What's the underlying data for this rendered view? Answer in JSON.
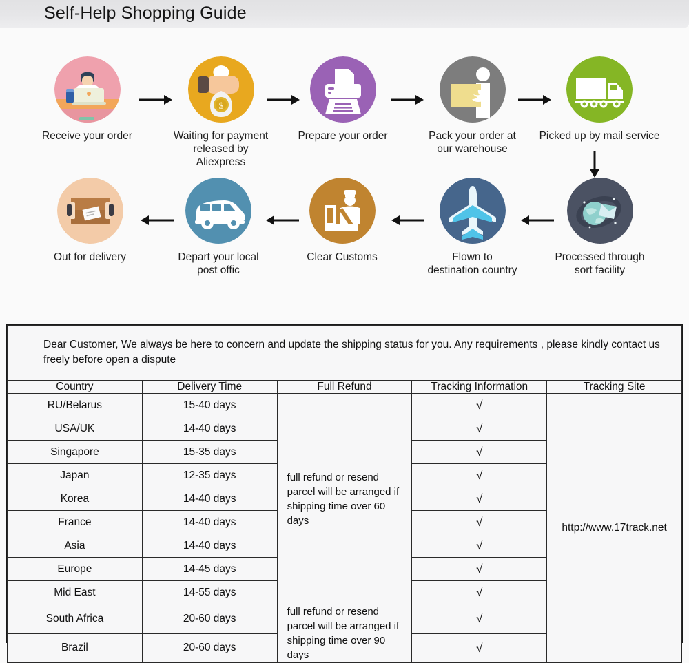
{
  "header": {
    "title": "Self-Help Shopping Guide"
  },
  "flow": {
    "row1": [
      {
        "label": "Receive your order",
        "icon": "person-at-laptop-icon",
        "color": "#efa1ad"
      },
      {
        "label": "Waiting for payment\nreleased by Aliexpress",
        "icon": "hand-money-bag-icon",
        "color": "#e8a81f"
      },
      {
        "label": "Prepare your order",
        "icon": "printer-icon",
        "color": "#9a62b5"
      },
      {
        "label": "Pack your order at\nour warehouse",
        "icon": "worker-with-box-icon",
        "color": "#7d7d7d"
      },
      {
        "label": "Picked up by mail service",
        "icon": "delivery-truck-icon",
        "color": "#85b625"
      }
    ],
    "row2": [
      {
        "label": "Out for delivery",
        "icon": "parcel-box-icon",
        "color": "#f3cba8"
      },
      {
        "label": "Depart your local\npost offic",
        "icon": "delivery-van-icon",
        "color": "#5290b0"
      },
      {
        "label": "Clear  Customs",
        "icon": "customs-officer-icon",
        "color": "#c08430"
      },
      {
        "label": "Flown to\ndestination country",
        "icon": "airplane-icon",
        "color": "#46668c"
      },
      {
        "label": "Processed through\nsort facility",
        "icon": "globe-envelope-icon",
        "color": "#4b5263"
      }
    ],
    "arrows": {
      "right": "arrow-right-icon",
      "left": "arrow-left-icon",
      "down": "arrow-down-icon"
    }
  },
  "table": {
    "notice": "Dear Customer, We always be here to concern and update the shipping status for you.  Any requirements , please kindly contact us freely before open a dispute",
    "columns": [
      "Country",
      "Delivery Time",
      "Full Refund",
      "Tracking Information",
      "Tracking Site"
    ],
    "rows": [
      {
        "country": "RU/Belarus",
        "time": "15-40 days",
        "tracking": "√"
      },
      {
        "country": "USA/UK",
        "time": "14-40 days",
        "tracking": "√"
      },
      {
        "country": "Singapore",
        "time": "15-35 days",
        "tracking": "√"
      },
      {
        "country": "Japan",
        "time": "12-35 days",
        "tracking": "√"
      },
      {
        "country": "Korea",
        "time": "14-40 days",
        "tracking": "√"
      },
      {
        "country": "France",
        "time": "14-40 days",
        "tracking": "√"
      },
      {
        "country": "Asia",
        "time": "14-40 days",
        "tracking": "√"
      },
      {
        "country": "Europe",
        "time": "14-45 days",
        "tracking": "√"
      },
      {
        "country": "Mid East",
        "time": "14-55 days",
        "tracking": "√"
      },
      {
        "country": "South Africa",
        "time": "20-60 days",
        "tracking": "√"
      },
      {
        "country": "Brazil",
        "time": "20-60 days",
        "tracking": "√"
      }
    ],
    "refund_groups": [
      {
        "text": "full refund or resend parcel will be arranged if shipping time over 60 days",
        "rowspan": 9
      },
      {
        "text": "full refund or resend parcel will be arranged if shipping time over 90 days",
        "rowspan": 2
      }
    ],
    "tracking_site": "http://www.17track.net"
  }
}
